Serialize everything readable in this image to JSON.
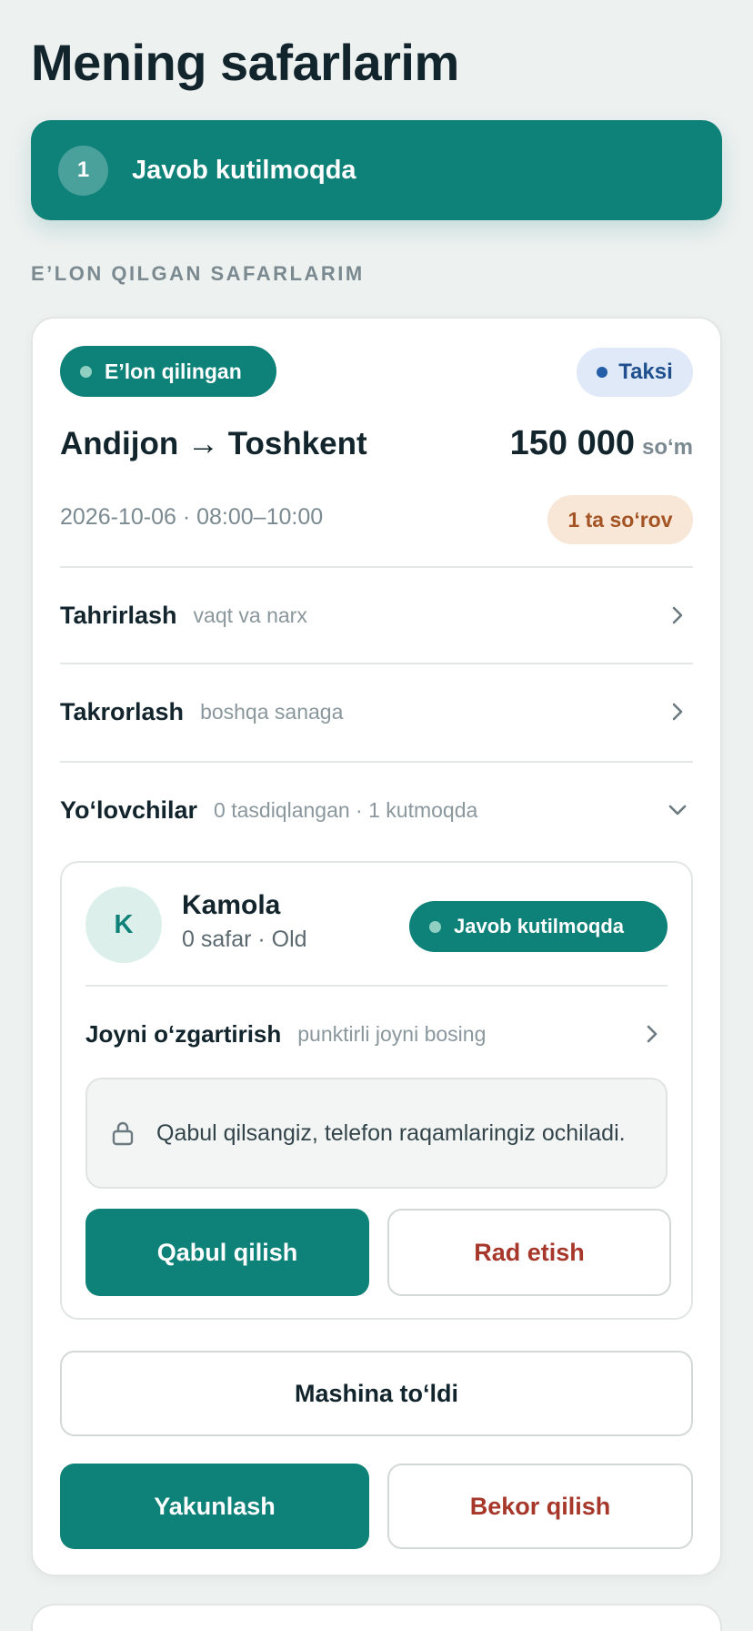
{
  "page_title": "Mening safarlarim",
  "banner": {
    "count": "1",
    "text": "Javob kutilmoqda"
  },
  "section_label": "E’LON QILGAN SAFARLARIM",
  "trip": {
    "status": "E’lon qilingan",
    "type": "Taksi",
    "route": "Andijon → Toshkent",
    "price": "150 000",
    "currency": "so‘m",
    "datetime": "2026-10-06 · 08:00–10:00",
    "requests_badge": "1 ta so‘rov",
    "rows": {
      "edit": {
        "label": "Tahrirlash",
        "hint": "vaqt va narx"
      },
      "repeat": {
        "label": "Takrorlash",
        "hint": "boshqa sanaga"
      },
      "passengers": {
        "label": "Yo‘lovchilar",
        "hint": "0 tasdiqlangan · 1 kutmoqda"
      }
    },
    "passenger": {
      "initial": "K",
      "name": "Kamola",
      "meta": "0 safar · Old",
      "status": "Javob kutilmoqda",
      "change_seat_label": "Joyni o‘zgartirish",
      "change_seat_hint": "punktirli joyni bosing",
      "notice": "Qabul qilsangiz, telefon raqamlaringiz ochiladi.",
      "accept_label": "Qabul qilish",
      "reject_label": "Rad etish"
    },
    "car_full_label": "Mashina to‘ldi",
    "finish_label": "Yakunlash",
    "cancel_label": "Bekor qilish"
  },
  "icons": {
    "chevron_right": "chevron-right-icon",
    "chevron_down": "chevron-down-icon",
    "lock": "lock-icon"
  },
  "colors": {
    "accent": "#0e8178",
    "danger": "#a7372a",
    "taxi_bg": "#dfe9f7",
    "request_bg": "#f8e6d6"
  }
}
